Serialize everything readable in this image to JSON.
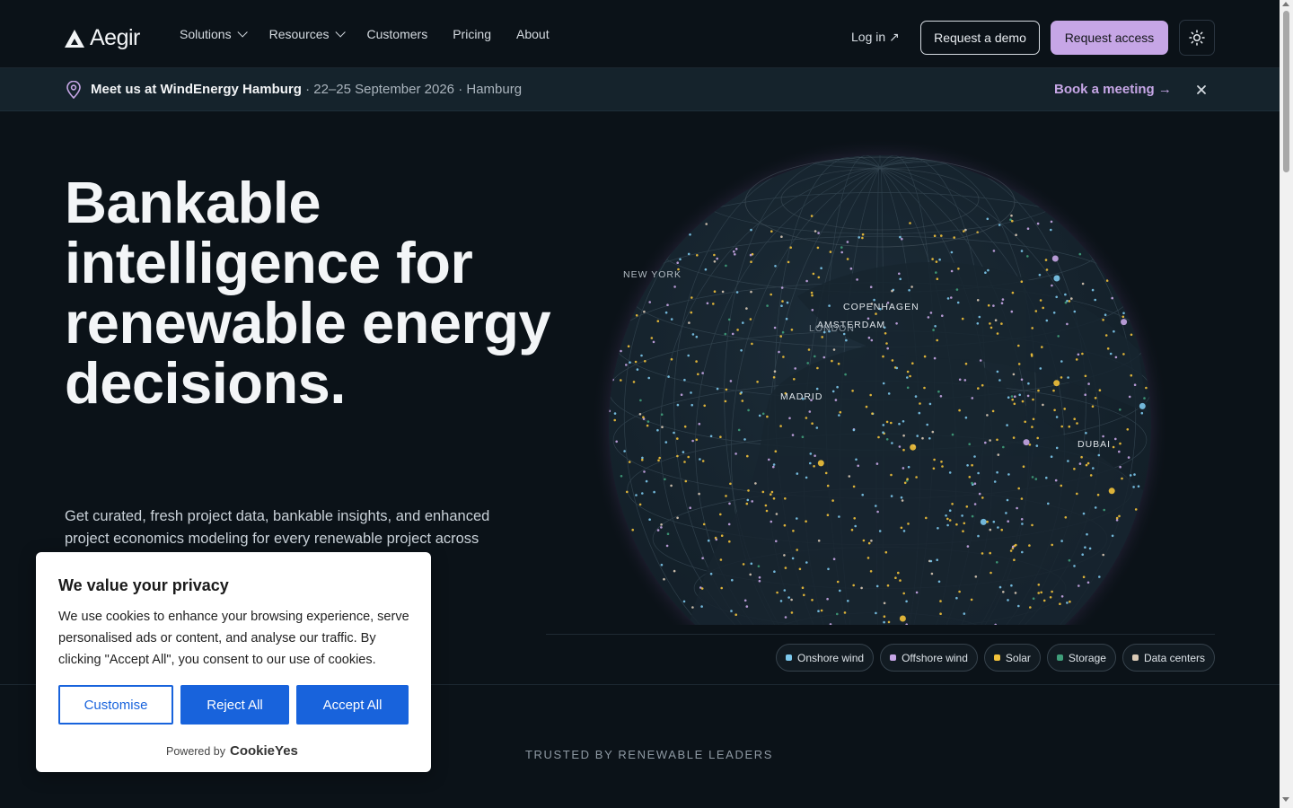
{
  "brand": {
    "name": "Aegir"
  },
  "nav": {
    "items": [
      {
        "label": "Solutions",
        "dropdown": true
      },
      {
        "label": "Resources",
        "dropdown": true
      },
      {
        "label": "Customers",
        "dropdown": false
      },
      {
        "label": "Pricing",
        "dropdown": false
      },
      {
        "label": "About",
        "dropdown": false
      }
    ],
    "login": "Log in ↗",
    "demo": "Request a demo",
    "access": "Request access",
    "theme_icon": "sun-icon"
  },
  "banner": {
    "event": "Meet us at WindEnergy Hamburg",
    "details": " · 22–25 September 2026 · Hamburg",
    "cta": "Book a meeting →",
    "close_icon": "close-icon"
  },
  "hero": {
    "headline": "Bankable intelligence for renewable energy decisions.",
    "subtitle": "Get curated, fresh project data, bankable insights, and enhanced project economics modeling for every renewable project across"
  },
  "globe": {
    "cities": [
      "NEW YORK",
      "COPENHAGEN",
      "AMSTERDAM",
      "LONDON",
      "MADRID",
      "DUBAI"
    ],
    "legend": [
      {
        "label": "Onshore wind",
        "color": "#7cc8ec"
      },
      {
        "label": "Offshore wind",
        "color": "#c6a6e6"
      },
      {
        "label": "Solar",
        "color": "#f2c23a"
      },
      {
        "label": "Storage",
        "color": "#3f9e7a"
      },
      {
        "label": "Data centers",
        "color": "#d9c9b5"
      }
    ]
  },
  "trusted": "TRUSTED BY RENEWABLE LEADERS",
  "cookie": {
    "title": "We value your privacy",
    "body": "We use cookies to enhance your browsing experience, serve personalised ads or content, and analyse our traffic. By clicking \"Accept All\", you consent to our use of cookies.",
    "customise": "Customise",
    "reject": "Reject All",
    "accept": "Accept All",
    "powered_by": "Powered by",
    "powered_brand": "CookieYes"
  },
  "colors": {
    "accent": "#c6a6e6",
    "background": "#0b1218",
    "cookie_button": "#1863dc"
  }
}
